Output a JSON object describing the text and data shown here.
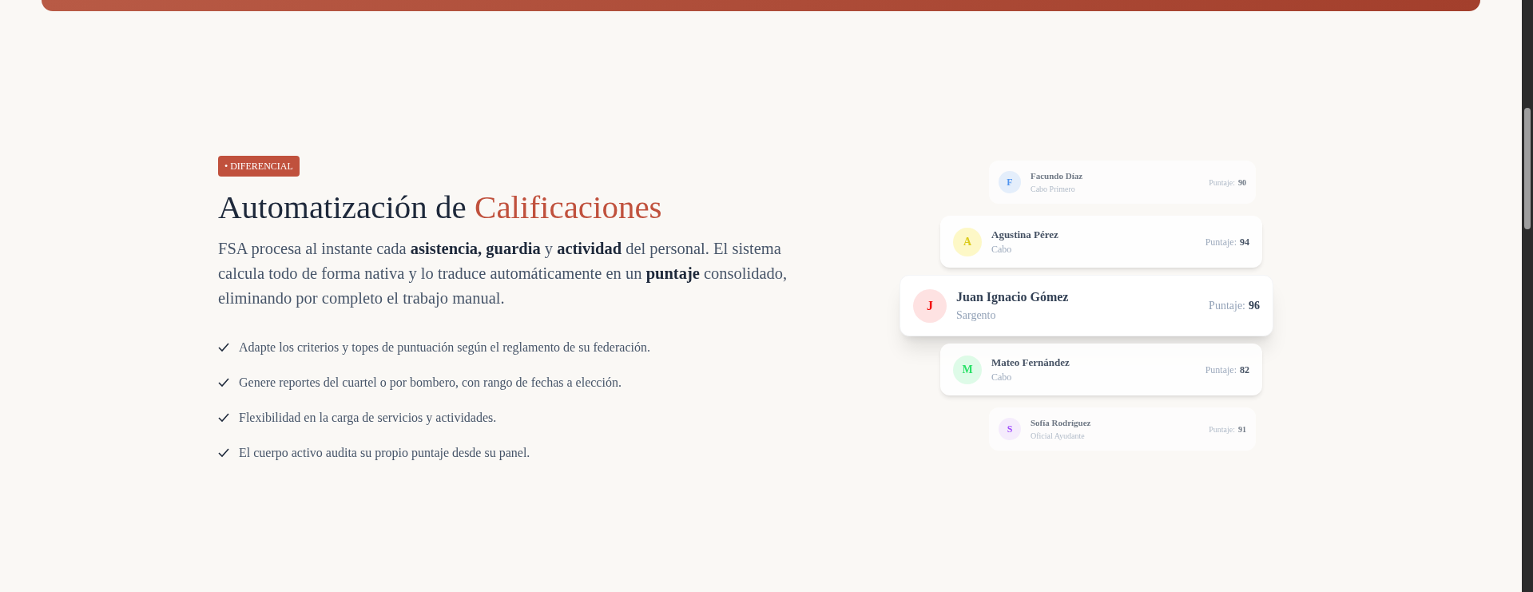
{
  "badge": "• DIFERENCIAL",
  "heading": {
    "lead": "Automatización de",
    "accent": "Calificaciones"
  },
  "description": "FSA procesa al instante cada **asistencia, guardia** y **actividad** del personal. El sistema calcula todo de forma nativa y lo traduce automáticamente en un **puntaje** consolidado, eliminando por completo el trabajo manual.",
  "features": [
    "Adapte los criterios y topes de puntuación según el reglamento de su federación.",
    "Genere reportes del cuartel o por bombero, con rango de fechas a elección.",
    "Flexibilidad en la carga de servicios y actividades.",
    "El cuerpo activo audita su propio puntaje desde su panel."
  ],
  "ranking": [
    {
      "kind": "faded",
      "initial": "F",
      "name": "Facundo Díaz",
      "rank": "Cabo Primero",
      "score_label": "Puntaje:",
      "score": "90",
      "color": "#dbeafe"
    },
    {
      "kind": "normal",
      "initial": "A",
      "name": "Agustina Pérez",
      "rank": "Cabo",
      "score_label": "Puntaje:",
      "score": "94",
      "color": "#fef9c3"
    },
    {
      "kind": "focused",
      "initial": "J",
      "name": "Juan Ignacio Gómez",
      "rank": "Sargento",
      "score_label": "Puntaje:",
      "score": "96",
      "color": "#fee2e2"
    },
    {
      "kind": "normal",
      "initial": "M",
      "name": "Mateo Fernández",
      "rank": "Cabo",
      "score_label": "Puntaje:",
      "score": "82",
      "color": "#dcfce7"
    },
    {
      "kind": "faded",
      "initial": "S",
      "name": "Sofía Rodríguez",
      "rank": "Oficial Ayudante",
      "score_label": "Puntaje:",
      "score": "91",
      "color": "#f3e8ff"
    }
  ]
}
